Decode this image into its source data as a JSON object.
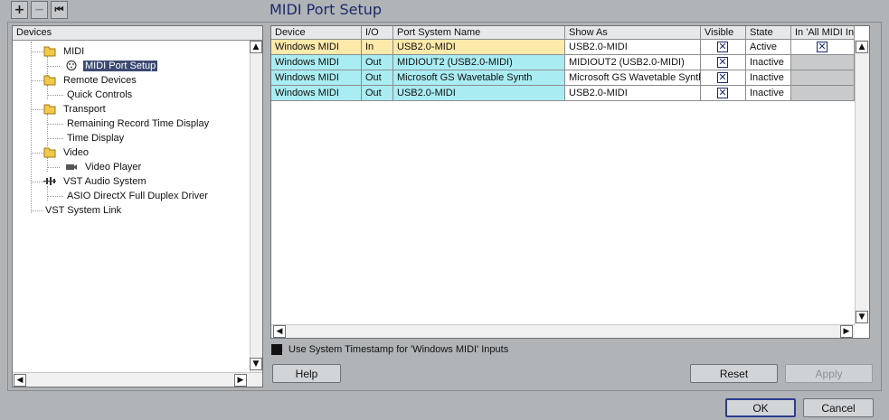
{
  "toolbar": {
    "add_label": "+",
    "remove_label": "−",
    "reset_label": "⏮"
  },
  "page": {
    "title": "MIDI Port Setup"
  },
  "tree": {
    "header": "Devices",
    "nodes": [
      {
        "label": "MIDI",
        "icon": "folder-icon"
      },
      {
        "label": "MIDI Port Setup",
        "icon": "midi-port-icon",
        "selected": true
      },
      {
        "label": "Remote Devices",
        "icon": "folder-icon"
      },
      {
        "label": "Quick Controls",
        "icon": ""
      },
      {
        "label": "Transport",
        "icon": "folder-icon"
      },
      {
        "label": "Remaining Record Time Display",
        "icon": ""
      },
      {
        "label": "Time Display",
        "icon": ""
      },
      {
        "label": "Video",
        "icon": "folder-icon"
      },
      {
        "label": "Video Player",
        "icon": "video-icon"
      },
      {
        "label": "VST Audio System",
        "icon": "audio-system-icon"
      },
      {
        "label": "ASIO DirectX Full Duplex Driver",
        "icon": ""
      },
      {
        "label": "VST System Link",
        "icon": ""
      }
    ],
    "scroll_up": "▲",
    "scroll_down": "▼",
    "scroll_left": "◀",
    "scroll_right": "▶"
  },
  "table": {
    "columns": [
      "Device",
      "I/O",
      "Port System Name",
      "Show As",
      "Visible",
      "State",
      "In 'All MIDI Inputs'"
    ],
    "rows": [
      {
        "device": "Windows MIDI",
        "io": "In",
        "port": "USB2.0-MIDI",
        "show_as": "USB2.0-MIDI",
        "visible": true,
        "state": "Active",
        "all_inputs": true,
        "has_all_inputs": true
      },
      {
        "device": "Windows MIDI",
        "io": "Out",
        "port": "MIDIOUT2 (USB2.0-MIDI)",
        "show_as": "MIDIOUT2 (USB2.0-MIDI)",
        "visible": true,
        "state": "Inactive",
        "has_all_inputs": false
      },
      {
        "device": "Windows MIDI",
        "io": "Out",
        "port": "Microsoft GS Wavetable Synth",
        "show_as": "Microsoft GS Wavetable Synth",
        "visible": true,
        "state": "Inactive",
        "has_all_inputs": false
      },
      {
        "device": "Windows MIDI",
        "io": "Out",
        "port": "USB2.0-MIDI",
        "show_as": "USB2.0-MIDI",
        "visible": true,
        "state": "Inactive",
        "has_all_inputs": false
      }
    ],
    "check_glyph": "✕",
    "scroll_up": "▲",
    "scroll_down": "▼",
    "scroll_left": "◀",
    "scroll_right": "▶"
  },
  "options": {
    "timestamp_label": "Use System Timestamp for 'Windows MIDI' Inputs",
    "timestamp_checked": true
  },
  "buttons": {
    "help": "Help",
    "reset": "Reset",
    "apply": "Apply",
    "ok": "OK",
    "cancel": "Cancel"
  },
  "colors": {
    "in_row": "#fde9a9",
    "out_row": "#a9ecf2",
    "inactive_cell": "#c8cacc",
    "selection": "#3d4b73"
  }
}
